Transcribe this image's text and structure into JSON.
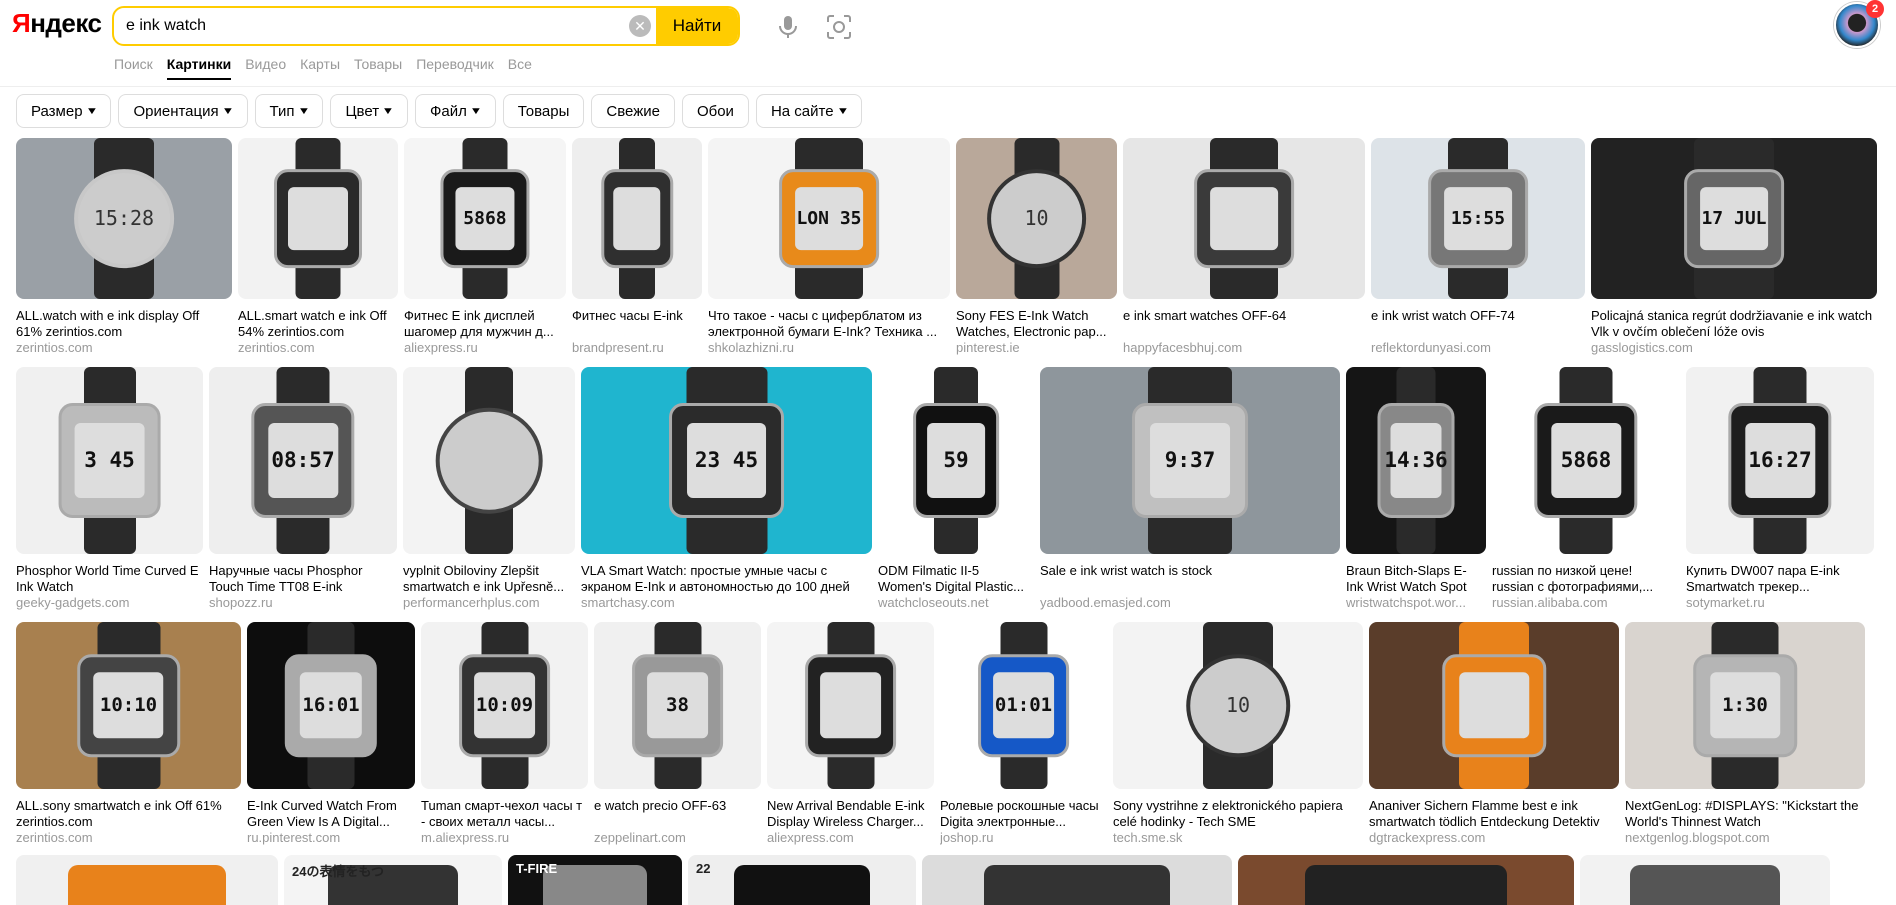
{
  "header": {
    "logo_first": "Я",
    "logo_rest": "ндекс",
    "search_value": "e ink watch",
    "find_label": "Найти",
    "badge_count": "2"
  },
  "nav": [
    "Поиск",
    "Картинки",
    "Видео",
    "Карты",
    "Товары",
    "Переводчик",
    "Все"
  ],
  "nav_active": "Картинки",
  "filters": [
    {
      "label": "Размер",
      "dropdown": true
    },
    {
      "label": "Ориентация",
      "dropdown": true
    },
    {
      "label": "Тип",
      "dropdown": true
    },
    {
      "label": "Цвет",
      "dropdown": true
    },
    {
      "label": "Файл",
      "dropdown": true
    },
    {
      "label": "Товары",
      "dropdown": false
    },
    {
      "label": "Свежие",
      "dropdown": false
    },
    {
      "label": "Обои",
      "dropdown": false
    },
    {
      "label": "На сайте",
      "dropdown": true
    }
  ],
  "rows": [
    [
      {
        "caption": "ALL.watch with e ink display Off 61% zerintios.com",
        "site": "zerintios.com",
        "screen": "15:28",
        "style": "round",
        "bg": "#9aa0a6",
        "case": "#c8c8c8"
      },
      {
        "caption": "ALL.smart watch e ink Off 54% zerintios.com",
        "site": "zerintios.com",
        "screen": "",
        "style": "square",
        "bg": "#f2f2f2",
        "case": "#2a2a2a"
      },
      {
        "caption": "Фитнес E ink дисплей шагомер для мужчин д...",
        "site": "aliexpress.ru",
        "screen": "5868",
        "style": "square",
        "bg": "#f5f5f5",
        "case": "#1a1a1a"
      },
      {
        "caption": "Фитнес часы E-ink",
        "site": "brandpresent.ru",
        "screen": "",
        "style": "square",
        "bg": "#eeeeee",
        "case": "#2f2f2f"
      },
      {
        "caption": "Что такое - часы с циферблатом из электронной бумаги E-Ink? Техника ...",
        "site": "shkolazhizni.ru",
        "screen": "LON 35",
        "style": "square",
        "bg": "#f4f4f4",
        "case": "#e88a1a"
      },
      {
        "caption": "Sony FES E-Ink Watch Watches, Electronic pap...",
        "site": "pinterest.ie",
        "screen": "10",
        "style": "round",
        "bg": "#b9a89a",
        "case": "#333333"
      },
      {
        "caption": "e ink smart watches OFF-64",
        "site": "happyfacesbhuj.com",
        "screen": "",
        "style": "square",
        "bg": "#e6e6e6",
        "case": "#3a3a3a"
      },
      {
        "caption": "e ink wrist watch OFF-74",
        "site": "reflektordunyasi.com",
        "screen": "15:55",
        "style": "square",
        "bg": "#dde3e8",
        "case": "#777777"
      },
      {
        "caption": "Policajná stanica regrút dodržiavanie e ink watch Vlk v ovčím oblečení lóže ovis",
        "site": "gasslogistics.com",
        "screen": "17 JUL",
        "style": "square",
        "bg": "#222222",
        "case": "#666666"
      }
    ],
    [
      {
        "caption": "Phosphor World Time Curved E Ink Watch",
        "site": "geeky-gadgets.com",
        "screen": "3 45",
        "style": "square",
        "bg": "#f0f0f0",
        "case": "#bbbbbb"
      },
      {
        "caption": "Наручные часы Phosphor Touch Time TT08 E-ink Watch...",
        "site": "shopozz.ru",
        "screen": "08:57",
        "style": "square",
        "bg": "#eeeeee",
        "case": "#555555"
      },
      {
        "caption": "vyplnit Obiloviny Zlepšit smartwatch e ink Upřesně...",
        "site": "performancerhplus.com",
        "screen": "",
        "style": "round",
        "bg": "#f3f3f3",
        "case": "#444444"
      },
      {
        "caption": "VLA Smart Watch: простые умные часы с экраном E-Ink и автономностью до 100 дней",
        "site": "smartchasy.com",
        "screen": "23 45",
        "style": "square",
        "bg": "#1fb5cf",
        "case": "#2b2b2b"
      },
      {
        "caption": "ODM Filmatic II-5 Women's Digital Plastic...",
        "site": "watchcloseouts.net",
        "screen": "59",
        "style": "square",
        "bg": "#ffffff",
        "case": "#111111"
      },
      {
        "caption": "Sale e ink wrist watch is stock",
        "site": "yadbood.emasjed.com",
        "screen": "9:37",
        "style": "square",
        "bg": "#8e969c",
        "case": "#c0c0c0"
      },
      {
        "caption": "Braun Bitch-Slaps E-Ink Wrist Watch Spot",
        "site": "wristwatchspot.wor...",
        "screen": "14:36",
        "style": "square",
        "bg": "#151515",
        "case": "#888888"
      },
      {
        "caption": "russian по низкой цене! russian с фотографиями,...",
        "site": "russian.alibaba.com",
        "screen": "5868",
        "style": "square",
        "bg": "#ffffff",
        "case": "#1a1a1a"
      },
      {
        "caption": "Купить DW007 пара E-ink Smartwatch трекер...",
        "site": "sotymarket.ru",
        "screen": "16:27",
        "style": "square",
        "bg": "#f1f1f1",
        "case": "#1e1e1e"
      }
    ],
    [
      {
        "caption": "ALL.sony smartwatch e ink Off 61% zerintios.com",
        "site": "zerintios.com",
        "screen": "10:10",
        "style": "square",
        "bg": "#a8804f",
        "case": "#444444"
      },
      {
        "caption": "E-Ink Curved Watch From Green View Is A Digital...",
        "site": "ru.pinterest.com",
        "screen": "16:01",
        "style": "square",
        "bg": "#0d0d0d",
        "case": "#aaaaaa"
      },
      {
        "caption": "Tuman смарт-чехол часы т - своих металл часы...",
        "site": "m.aliexpress.ru",
        "screen": "10:09",
        "style": "square",
        "bg": "#f2f2f2",
        "case": "#333333"
      },
      {
        "caption": "e watch precio OFF-63",
        "site": "zeppelinart.com",
        "screen": "38",
        "style": "square",
        "bg": "#f0f0f0",
        "case": "#999999"
      },
      {
        "caption": "New Arrival Bendable E-ink Display Wireless Charger...",
        "site": "aliexpress.com",
        "screen": "",
        "style": "square",
        "bg": "#f4f4f4",
        "case": "#222222"
      },
      {
        "caption": "Ролевые роскошные часы Digita электронные...",
        "site": "joshop.ru",
        "screen": "01:01",
        "style": "square",
        "bg": "#ffffff",
        "case": "#1558c7"
      },
      {
        "caption": "Sony vystrihne z elektronického papiera celé hodinky - Tech SME",
        "site": "tech.sme.sk",
        "screen": "10",
        "style": "round",
        "bg": "#f3f3f3",
        "case": "#333333"
      },
      {
        "caption": "Ananiver Sichern Flamme best e ink smartwatch tödlich Entdeckung Detektiv",
        "site": "dgtrackexpress.com",
        "screen": "",
        "style": "square",
        "bg": "#5a3d2a",
        "case": "#e8821b"
      },
      {
        "caption": "NextGenLog: #DISPLAYS: \"Kickstart the World's Thinnest Watch",
        "site": "nextgenlog.blogspot.com",
        "screen": "1:30",
        "style": "square",
        "bg": "#d9d4cf",
        "case": "#b5b5b5"
      }
    ]
  ],
  "row4": [
    {
      "bg": "#f0f0f0",
      "case": "#e8821b"
    },
    {
      "bg": "#f4f4f4",
      "case": "#333333"
    },
    {
      "bg": "#111111",
      "case": "#888888"
    },
    {
      "bg": "#eeeeee",
      "case": "#111111"
    },
    {
      "bg": "#dcdcdc",
      "case": "#333333"
    },
    {
      "bg": "#7a4a2e",
      "case": "#222222"
    },
    {
      "bg": "#f2f2f2",
      "case": "#555555"
    }
  ],
  "row4_labels": [
    "",
    "24の表情をもつ",
    "T-FIRE",
    "22",
    "",
    "",
    ""
  ]
}
